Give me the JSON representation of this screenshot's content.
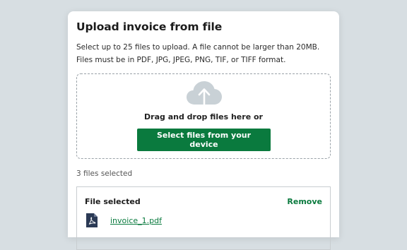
{
  "modal": {
    "title": "Upload invoice from file",
    "description_line1": "Select up to 25 files to upload. A file cannot be larger than 20MB.",
    "description_line2": "Files must be in PDF, JPG, JPEG, PNG, TIF, or TIFF format."
  },
  "dropzone": {
    "icon": "cloud-upload-icon",
    "drag_text": "Drag and drop files here or",
    "select_button_label": "Select files from your device"
  },
  "selection": {
    "count_text": "3 files selected"
  },
  "file_card": {
    "heading": "File selected",
    "remove_label": "Remove",
    "file_icon": "pdf-file-icon",
    "file_name": "invoice_1.pdf"
  },
  "colors": {
    "accent": "#0a7a3e",
    "background": "#d7dee2"
  }
}
